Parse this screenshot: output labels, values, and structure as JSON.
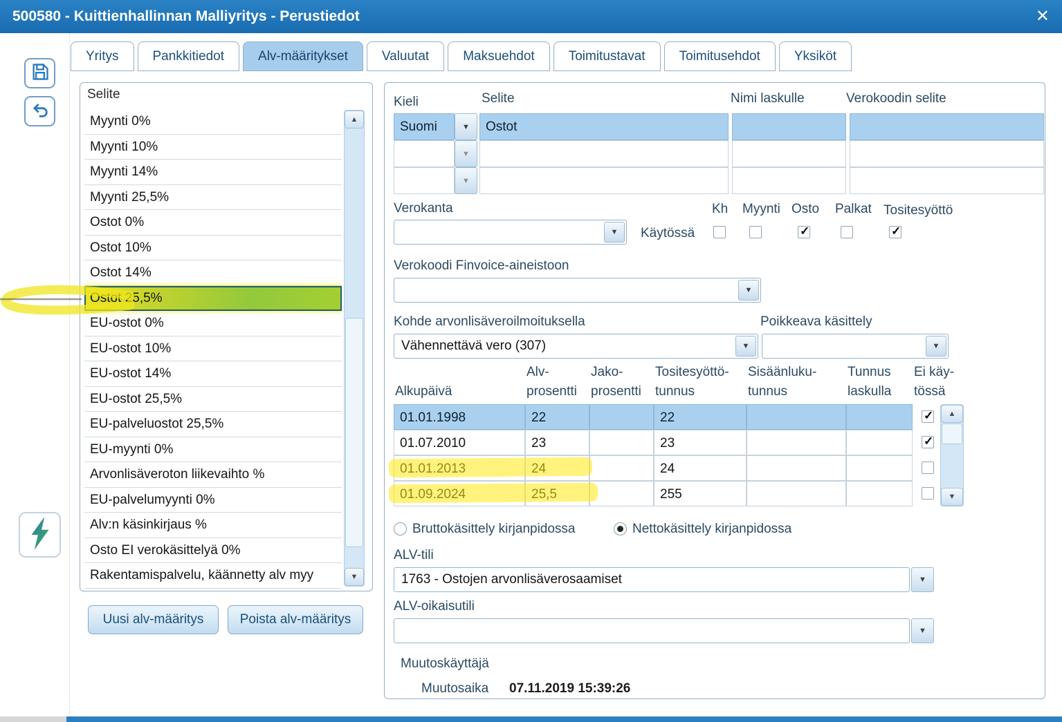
{
  "window": {
    "title": "500580 - Kuittienhallinnan Malliyritys - Perustiedot",
    "close_glyph": "✕"
  },
  "tabs": [
    "Yritys",
    "Pankkitiedot",
    "Alv-määritykset",
    "Valuutat",
    "Maksuehdot",
    "Toimitustavat",
    "Toimitusehdot",
    "Yksiköt"
  ],
  "active_tab": "Alv-määritykset",
  "left_panel": {
    "header": "Selite",
    "items": [
      "Myynti 0%",
      "Myynti 10%",
      "Myynti 14%",
      "Myynti 25,5%",
      "Ostot 0%",
      "Ostot 10%",
      "Ostot 14%",
      "Ostot 25,5%",
      "EU-ostot 0%",
      "EU-ostot 10%",
      "EU-ostot 14%",
      "EU-ostot 25,5%",
      "EU-palveluostot 25,5%",
      "EU-myynti 0%",
      "Arvonlisäveroton liikevaihto %",
      "EU-palvelumyynti 0%",
      "Alv:n käsinkirjaus %",
      "Osto EI verokäsittelyä 0%",
      "Rakentamispalvelu, käännetty alv myy"
    ],
    "selected_item": "Ostot 25,5%",
    "buttons": {
      "new_label": "Uusi alv-määritys",
      "delete_label": "Poista alv-määritys"
    }
  },
  "details": {
    "lang_section": {
      "col_kieli": "Kieli",
      "col_selite": "Selite",
      "col_nimi": "Nimi laskulle",
      "col_verokoodi": "Verokoodin selite",
      "rows": [
        {
          "kieli": "Suomi",
          "selite": "Ostot",
          "nimi": "",
          "verokoodi": ""
        },
        {
          "kieli": "",
          "selite": "",
          "nimi": "",
          "verokoodi": ""
        },
        {
          "kieli": "",
          "selite": "",
          "nimi": "",
          "verokoodi": ""
        }
      ]
    },
    "verokanta": {
      "label": "Verokanta",
      "value": ""
    },
    "kaytossa": {
      "label": "Käytössä",
      "options": [
        {
          "label": "Kh",
          "checked": false
        },
        {
          "label": "Myynti",
          "checked": false
        },
        {
          "label": "Osto",
          "checked": true
        },
        {
          "label": "Palkat",
          "checked": false
        },
        {
          "label": "Tositesyöttö",
          "checked": true
        }
      ]
    },
    "finvoice": {
      "label": "Verokoodi Finvoice-aineistoon",
      "value": ""
    },
    "kohde": {
      "label": "Kohde arvonlisäveroilmoituksella",
      "value": "Vähennettävä vero (307)"
    },
    "poikkeava": {
      "label": "Poikkeava käsittely",
      "value": ""
    },
    "rate_table": {
      "headers": [
        {
          "line1": "",
          "line2": "Alkupäivä"
        },
        {
          "line1": "Alv-",
          "line2": "prosentti"
        },
        {
          "line1": "Jako-",
          "line2": "prosentti"
        },
        {
          "line1": "Tositesyöttö-",
          "line2": "tunnus"
        },
        {
          "line1": "Sisäänluku-",
          "line2": "tunnus"
        },
        {
          "line1": "Tunnus",
          "line2": "laskulla"
        },
        {
          "line1": "Ei käy-",
          "line2": "tössä"
        }
      ],
      "rows": [
        {
          "alkupaiva": "01.01.1998",
          "alv_prosentti": "22",
          "jako_prosentti": "",
          "tositesyotto_tunnus": "22",
          "sisaanluku_tunnus": "",
          "tunnus_laskulla": "",
          "ei_kaytossa": true,
          "selected": true
        },
        {
          "alkupaiva": "01.07.2010",
          "alv_prosentti": "23",
          "jako_prosentti": "",
          "tositesyotto_tunnus": "23",
          "sisaanluku_tunnus": "",
          "tunnus_laskulla": "",
          "ei_kaytossa": true,
          "selected": false
        },
        {
          "alkupaiva": "01.01.2013",
          "alv_prosentti": "24",
          "jako_prosentti": "",
          "tositesyotto_tunnus": "24",
          "sisaanluku_tunnus": "",
          "tunnus_laskulla": "",
          "ei_kaytossa": false,
          "selected": false
        },
        {
          "alkupaiva": "01.09.2024",
          "alv_prosentti": "25,5",
          "jako_prosentti": "",
          "tositesyotto_tunnus": "255",
          "sisaanluku_tunnus": "",
          "tunnus_laskulla": "",
          "ei_kaytossa": false,
          "selected": false
        }
      ]
    },
    "accounting": {
      "brutto_label": "Bruttokäsittely kirjanpidossa",
      "netto_label": "Nettokäsittely kirjanpidossa",
      "selected": "netto"
    },
    "alv_tili": {
      "label": "ALV-tili",
      "value": "1763 - Ostojen arvonlisäverosaamiset"
    },
    "alv_oikaisutili": {
      "label": "ALV-oikaisutili",
      "value": ""
    },
    "muutos": {
      "kayttaja_label": "Muutoskäyttäjä",
      "aika_label": "Muutosaika",
      "aika_value": "07.11.2019 15:39:26"
    }
  }
}
